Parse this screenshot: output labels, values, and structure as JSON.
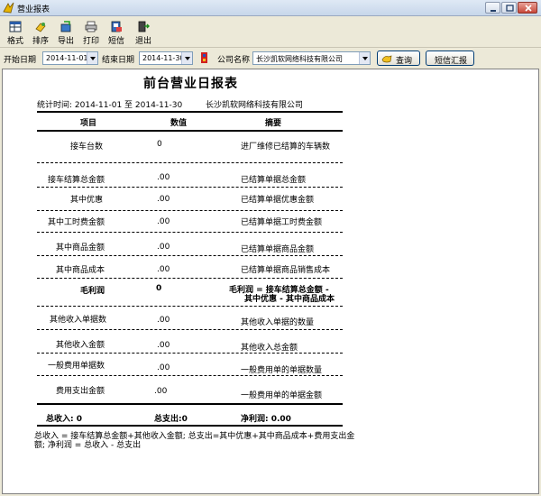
{
  "window": {
    "title": "营业报表"
  },
  "toolbar": {
    "buttons": [
      {
        "label": "格式",
        "icon": "format-icon"
      },
      {
        "label": "排序",
        "icon": "sort-icon"
      },
      {
        "label": "导出",
        "icon": "export-icon"
      },
      {
        "label": "打印",
        "icon": "print-icon"
      },
      {
        "label": "短信",
        "icon": "sms-icon"
      },
      {
        "label": "退出",
        "icon": "exit-icon"
      }
    ]
  },
  "filter": {
    "start_label": "开始日期",
    "start_value": "2014-11-01",
    "end_label": "结束日期",
    "end_value": "2014-11-30",
    "company_label": "公司名称",
    "company_value": "长沙凯软网络科技有限公司",
    "query_label": "查询",
    "sms_summary_label": "短信汇报"
  },
  "report": {
    "title": "前台营业日报表",
    "stat_text": "统计时间: 2014-11-01 至  2014-11-30",
    "company": "长沙凯软网络科技有限公司",
    "headers": {
      "item": "项目",
      "value": "数值",
      "summary": "摘要"
    },
    "rows": [
      {
        "item": "接车台数",
        "value": "0",
        "summary": "进厂维修已结算的车辆数"
      },
      {
        "item": "接车结算总金额",
        "value": ".00",
        "summary": "已结算单据总金额"
      },
      {
        "item": "其中优惠",
        "value": ".00",
        "summary": "已结算单据优惠金额"
      },
      {
        "item": "其中工时费金额",
        "value": ".00",
        "summary": "已结算单据工时费金额"
      },
      {
        "item": "其中商品金额",
        "value": ".00",
        "summary": "已结算单据商品金额"
      },
      {
        "item": "其中商品成本",
        "value": ".00",
        "summary": "已结算单据商品销售成本"
      },
      {
        "item": "毛利润",
        "value": "0",
        "summary": "毛利润 = 接车结算总金额 -",
        "summary2": "其中优惠 - 其中商品成本"
      },
      {
        "item": "其他收入单据数",
        "value": ".00",
        "summary": "其他收入单据的数量"
      },
      {
        "item": "其他收入金额",
        "value": ".00",
        "summary": "其他收入总金额"
      },
      {
        "item": "一般费用单据数",
        "value": ".00",
        "summary": "一般费用单的单据数量"
      },
      {
        "item": "费用支出金额",
        "value": ".00",
        "summary": "一般费用单的单据金额"
      }
    ],
    "totals": {
      "income": "总收入: 0",
      "expense": "总支出:0",
      "profit": "净利润: 0.00"
    },
    "footnote1": "总收入 = 接车结算总金额+其他收入金额; 总支出=其中优惠+其中商品成本+费用支出金",
    "footnote2": "额; 净利润 = 总收入 - 总支出"
  }
}
